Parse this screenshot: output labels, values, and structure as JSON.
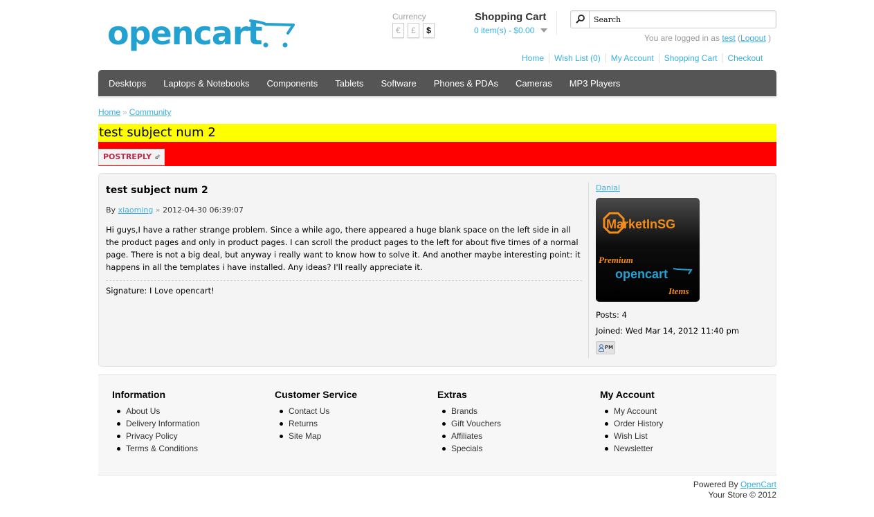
{
  "header": {
    "logo_text": "opencart",
    "currency": {
      "label": "Currency",
      "options": [
        "€",
        "£",
        "$"
      ],
      "selected": "$"
    },
    "cart": {
      "title": "Shopping Cart",
      "total": "0 item(s) - $0.00"
    },
    "search": {
      "placeholder": "Search"
    },
    "welcome": {
      "prefix": "You are logged in as",
      "username": "test",
      "open_paren": "(",
      "logout": "Logout",
      "close_paren": ")"
    },
    "top_links": [
      "Home",
      "Wish List (0)",
      "My Account",
      "Shopping Cart",
      "Checkout"
    ]
  },
  "menu": {
    "items": [
      "Desktops",
      "Laptops & Notebooks",
      "Components",
      "Tablets",
      "Software",
      "Phones & PDAs",
      "Cameras",
      "MP3 Players"
    ]
  },
  "breadcrumb": {
    "items": [
      "Home",
      "Community"
    ],
    "separator": "»"
  },
  "topic": {
    "subject": "test subject num 2",
    "postreply_label": "POSTREPLY"
  },
  "post": {
    "title": "test subject num 2",
    "by_label": "By",
    "author": "xiaoming",
    "separator": "»",
    "date": "2012-04-30 06:39:07",
    "content": "Hi guys,I have a rather strange problem. Since a while ago, there appeared a huge blank space on the left side in all the product pages and only in product pages. I can scroll the product pages to the left for about five times of a normal page. There is not a big deal, but anyway i really want to know how to solve it. And another maybe interesting point: it happens in all the templates i have installed. Any ideas? I'll really appreciate it.",
    "signature": "Signature: I Love opencart!"
  },
  "profile": {
    "username": "Danial",
    "avatar": {
      "brand": "MarketInSG",
      "line1": "Premium",
      "line2": "opencart",
      "line3": "Items"
    },
    "posts": "Posts: 4",
    "joined": "Joined: Wed Mar 14, 2012 11:40 pm",
    "pm_label": "PM"
  },
  "footer": {
    "columns": [
      {
        "title": "Information",
        "links": [
          "About Us",
          "Delivery Information",
          "Privacy Policy",
          "Terms & Conditions"
        ]
      },
      {
        "title": "Customer Service",
        "links": [
          "Contact Us",
          "Returns",
          "Site Map"
        ]
      },
      {
        "title": "Extras",
        "links": [
          "Brands",
          "Gift Vouchers",
          "Affiliates",
          "Specials"
        ]
      },
      {
        "title": "My Account",
        "links": [
          "My Account",
          "Order History",
          "Wish List",
          "Newsletter"
        ]
      }
    ],
    "powered_prefix": "Powered By",
    "powered_link": "OpenCart",
    "copyright": "Your Store © 2012"
  },
  "colors": {
    "accent": "#38b0e3",
    "logo": "#23a1d1",
    "menu_bg": "#555555",
    "subject_bg": "#ffff00",
    "reply_bar_bg": "#ff0000",
    "postreply_text": "#bc2a4d",
    "avatar_orange": "#f28c1a"
  }
}
